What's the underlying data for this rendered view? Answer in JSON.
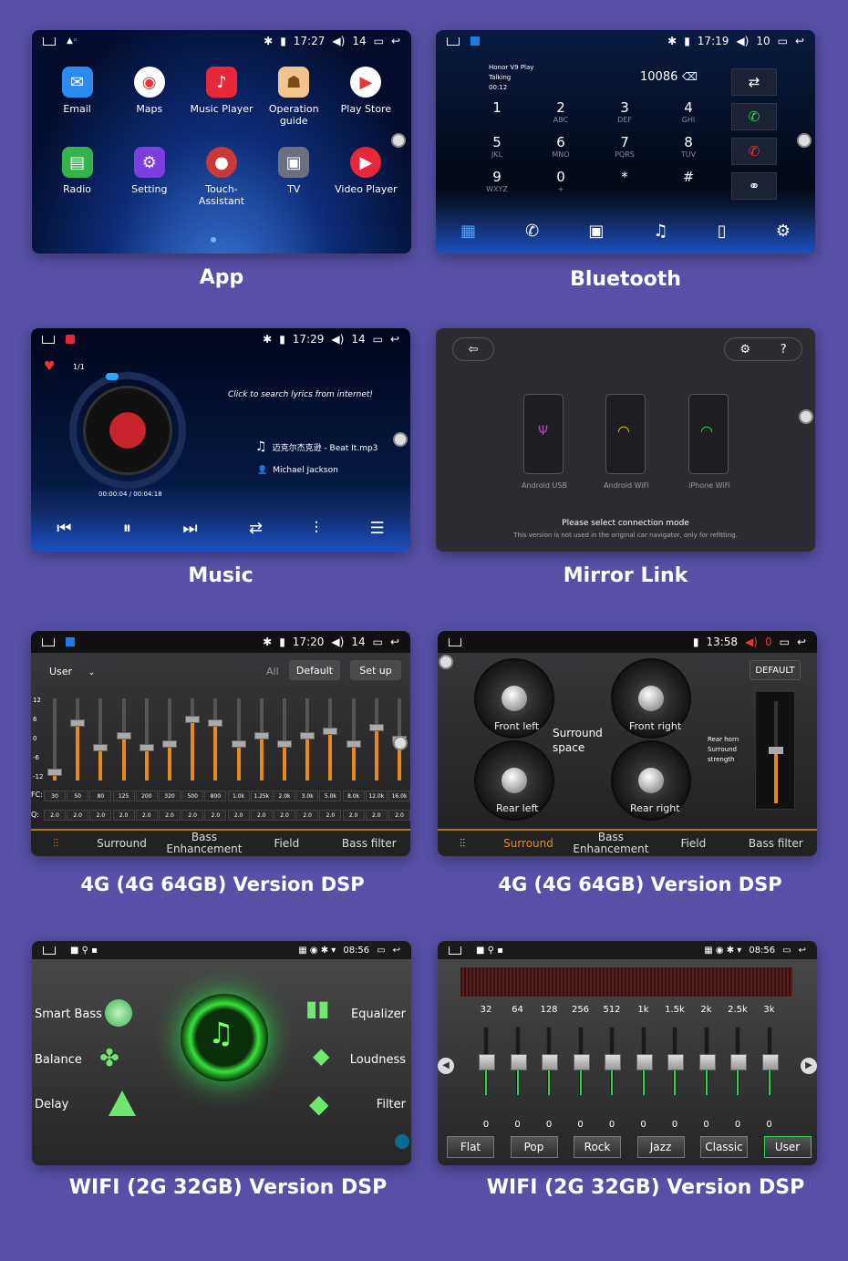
{
  "captions": {
    "app": "App",
    "bluetooth": "Bluetooth",
    "music": "Music",
    "mirror": "Mirror Link",
    "dsp4g_a": "4G (4G 64GB) Version DSP",
    "dsp4g_b": "4G (4G 64GB) Version DSP",
    "wifi_a": "WIFI (2G 32GB) Version DSP",
    "wifi_b": "WIFI (2G 32GB) Version DSP"
  },
  "app": {
    "time": "17:27",
    "vol": "14",
    "apps": [
      "Email",
      "Maps",
      "Music Player",
      "Operation guide",
      "Play Store",
      "Radio",
      "Setting",
      "Touch-Assistant",
      "TV",
      "Video Player"
    ]
  },
  "bluetooth": {
    "time": "17:19",
    "vol": "10",
    "device": "Honor V9 Play",
    "status": "Talking",
    "duration": "00:12",
    "number": "10086",
    "keys": [
      {
        "d": "1",
        "l": ""
      },
      {
        "d": "2",
        "l": "ABC"
      },
      {
        "d": "3",
        "l": "DEF"
      },
      {
        "d": "4",
        "l": "GHI"
      },
      {
        "d": "5",
        "l": "JKL"
      },
      {
        "d": "6",
        "l": "MNO"
      },
      {
        "d": "7",
        "l": "PQRS"
      },
      {
        "d": "8",
        "l": "TUV"
      },
      {
        "d": "9",
        "l": "WXYZ"
      },
      {
        "d": "0",
        "l": "+"
      },
      {
        "d": "*",
        "l": ""
      },
      {
        "d": "#",
        "l": ""
      }
    ]
  },
  "music": {
    "time": "17:29",
    "vol": "14",
    "track_index": "1/1",
    "lyrics_hint": "Click to search lyrics from internet!",
    "track": "迈克尔杰克逊 - Beat It.mp3",
    "artist": "Michael Jackson",
    "progress": "00:00:04 / 00:04:18"
  },
  "mirror": {
    "modes": [
      "Android USB",
      "Android WiFi",
      "iPhone WiFi"
    ],
    "prompt": "Please select connection mode",
    "note": "This version is not used in the original car navigator, only for refitting."
  },
  "eq": {
    "time": "17:20",
    "vol": "14",
    "preset": "User",
    "all_label": "All",
    "default_label": "Default",
    "setup_label": "Set up",
    "y_ticks": [
      "12",
      "6",
      "0",
      "-6",
      "-12"
    ],
    "fc_label": "FC:",
    "q_label": "Q:",
    "freqs": [
      "30",
      "50",
      "80",
      "125",
      "200",
      "320",
      "500",
      "800",
      "1.0k",
      "1.25k",
      "2.0k",
      "3.0k",
      "5.0k",
      "8.0k",
      "12.0k",
      "16.0k"
    ],
    "q": [
      "2.0",
      "2.0",
      "2.0",
      "2.0",
      "2.0",
      "2.0",
      "2.0",
      "2.0",
      "2.0",
      "2.0",
      "2.0",
      "2.0",
      "2.0",
      "2.0",
      "2.0",
      "2.0"
    ],
    "levels": [
      0.1,
      0.7,
      0.4,
      0.55,
      0.4,
      0.45,
      0.75,
      0.7,
      0.45,
      0.55,
      0.45,
      0.55,
      0.6,
      0.45,
      0.65,
      0.5
    ],
    "tabs": [
      "Surround",
      "Bass Enhancement",
      "Field",
      "Bass filter"
    ]
  },
  "dsp": {
    "time": "13:58",
    "vol": "0",
    "default_label": "DEFAULT",
    "gauges": [
      "Front left",
      "Front right",
      "Rear left",
      "Rear right"
    ],
    "center_label": "Surround space",
    "side_label": "Rear horn Surround strength",
    "tabs": [
      "Surround",
      "Bass Enhancement",
      "Field",
      "Bass filter"
    ]
  },
  "wifi_a": {
    "time": "08:56",
    "left": [
      "Smart Bass",
      "Balance",
      "Delay"
    ],
    "right": [
      "Equalizer",
      "Loudness",
      "Filter"
    ]
  },
  "wifi_b": {
    "time": "08:56",
    "freqs": [
      "32",
      "64",
      "128",
      "256",
      "512",
      "1k",
      "1.5k",
      "2k",
      "2.5k",
      "3k"
    ],
    "values": [
      "0",
      "0",
      "0",
      "0",
      "0",
      "0",
      "0",
      "0",
      "0",
      "0"
    ],
    "presets": [
      "Flat",
      "Pop",
      "Rock",
      "Jazz",
      "Classic",
      "User"
    ],
    "active_preset": "User"
  }
}
